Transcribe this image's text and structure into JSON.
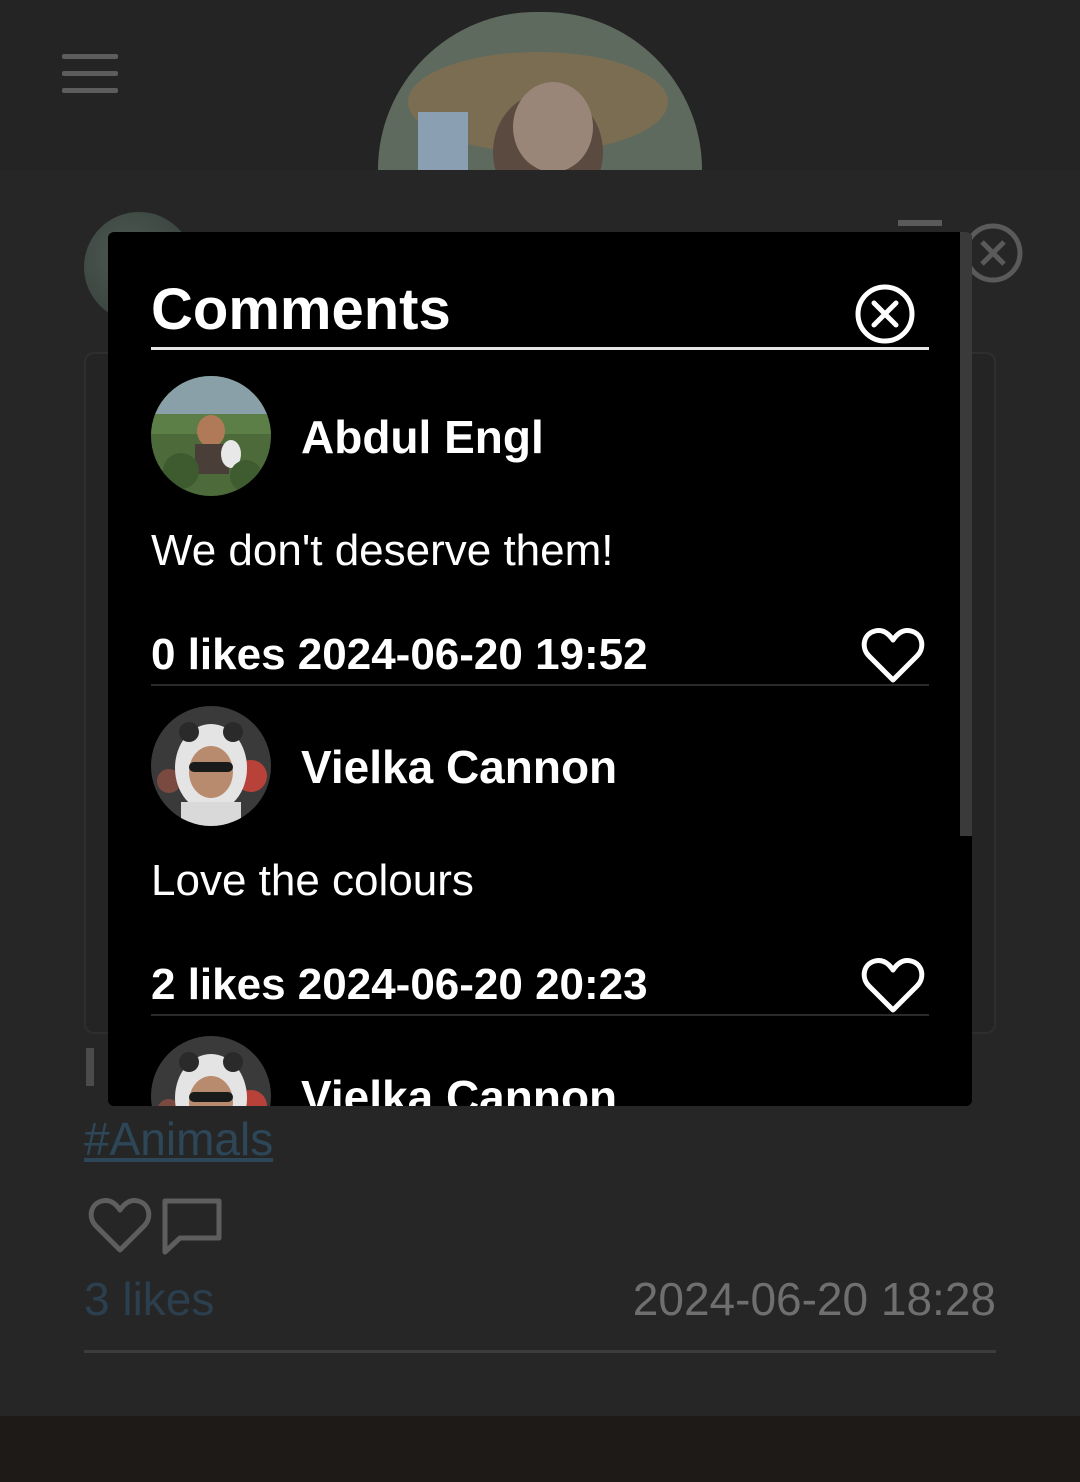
{
  "background": {
    "post": {
      "hashtag": "#Animals",
      "likes": "3 likes",
      "date": "2024-06-20 18:28"
    }
  },
  "modal": {
    "title": "Comments",
    "comments": [
      {
        "author": "Abdul Engl",
        "text": "We don't deserve them!",
        "meta": "0 likes 2024-06-20 19:52"
      },
      {
        "author": "Vielka Cannon",
        "text": "Love the colours",
        "meta": "2 likes 2024-06-20 20:23"
      },
      {
        "author": "Vielka Cannon",
        "text": "",
        "meta": ""
      }
    ]
  },
  "colors": {
    "background": "#262626",
    "modal": "#000000",
    "hashtag": "#2d4759",
    "likes_link": "#2b3f4e"
  }
}
